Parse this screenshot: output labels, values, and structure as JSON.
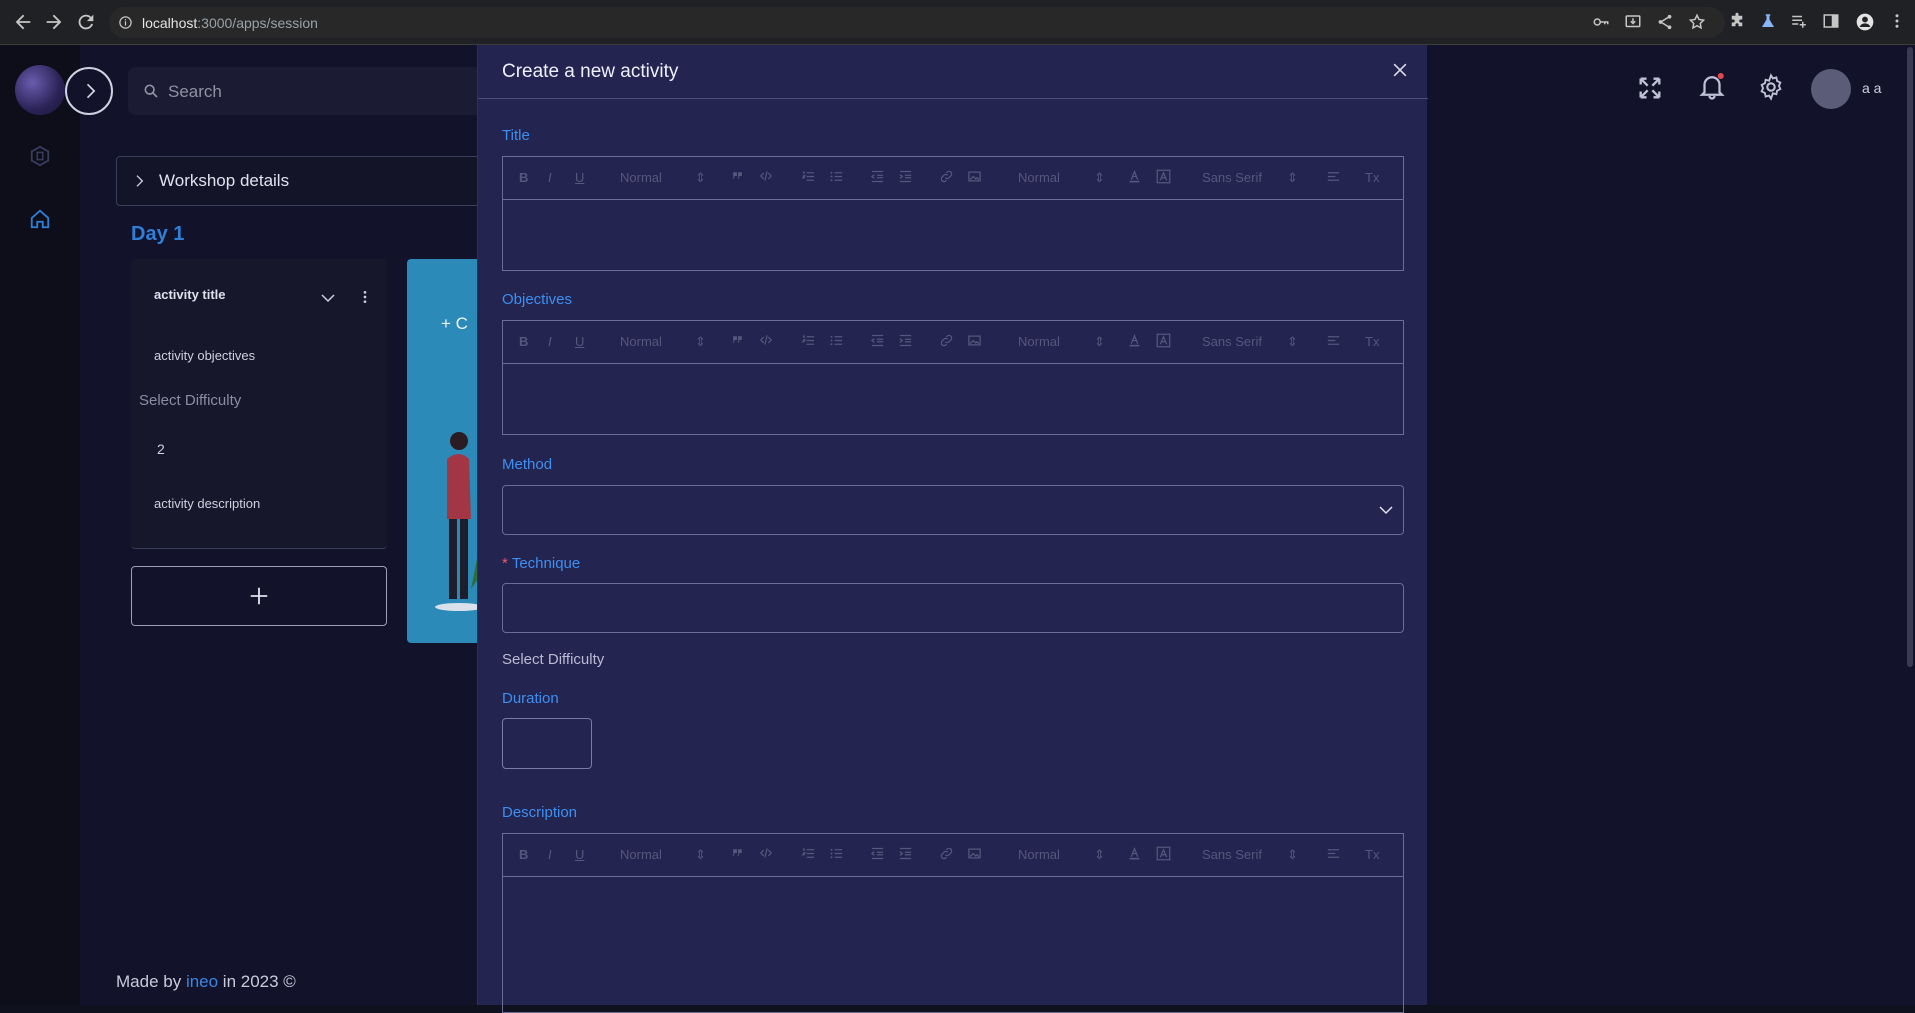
{
  "browser": {
    "url_host": "localhost",
    "url_path": ":3000/apps/session"
  },
  "sidebar": {
    "search_placeholder": "Search"
  },
  "workshop": {
    "details_label": "Workshop details",
    "day_label": "Day 1"
  },
  "activity_card": {
    "title": "activity title",
    "objectives": "activity objectives",
    "difficulty_label": "Select Difficulty",
    "difficulty_value": "2",
    "description": "activity description"
  },
  "add_card": {
    "label_partial": "+ C"
  },
  "footer": {
    "prefix": "Made by ",
    "brand": "ineo",
    "suffix": " in 2023 ©"
  },
  "header": {
    "username": "a a",
    "notification_dot_color": "#e5484d"
  },
  "modal": {
    "title": "Create a new activity",
    "fields": {
      "title_label": "Title",
      "objectives_label": "Objectives",
      "method_label": "Method",
      "technique_label": "Technique",
      "technique_required_mark": "*",
      "difficulty_label": "Select Difficulty",
      "duration_label": "Duration",
      "description_label": "Description"
    },
    "toolbar": {
      "bold": "B",
      "italic": "I",
      "underline": "U",
      "header_select": "Normal",
      "size_select": "Normal",
      "font_select": "Sans Serif",
      "clean": "Tx"
    }
  },
  "colors": {
    "accent": "#3d8ff0",
    "modal_bg": "#232450",
    "page_bg": "#12122a"
  }
}
